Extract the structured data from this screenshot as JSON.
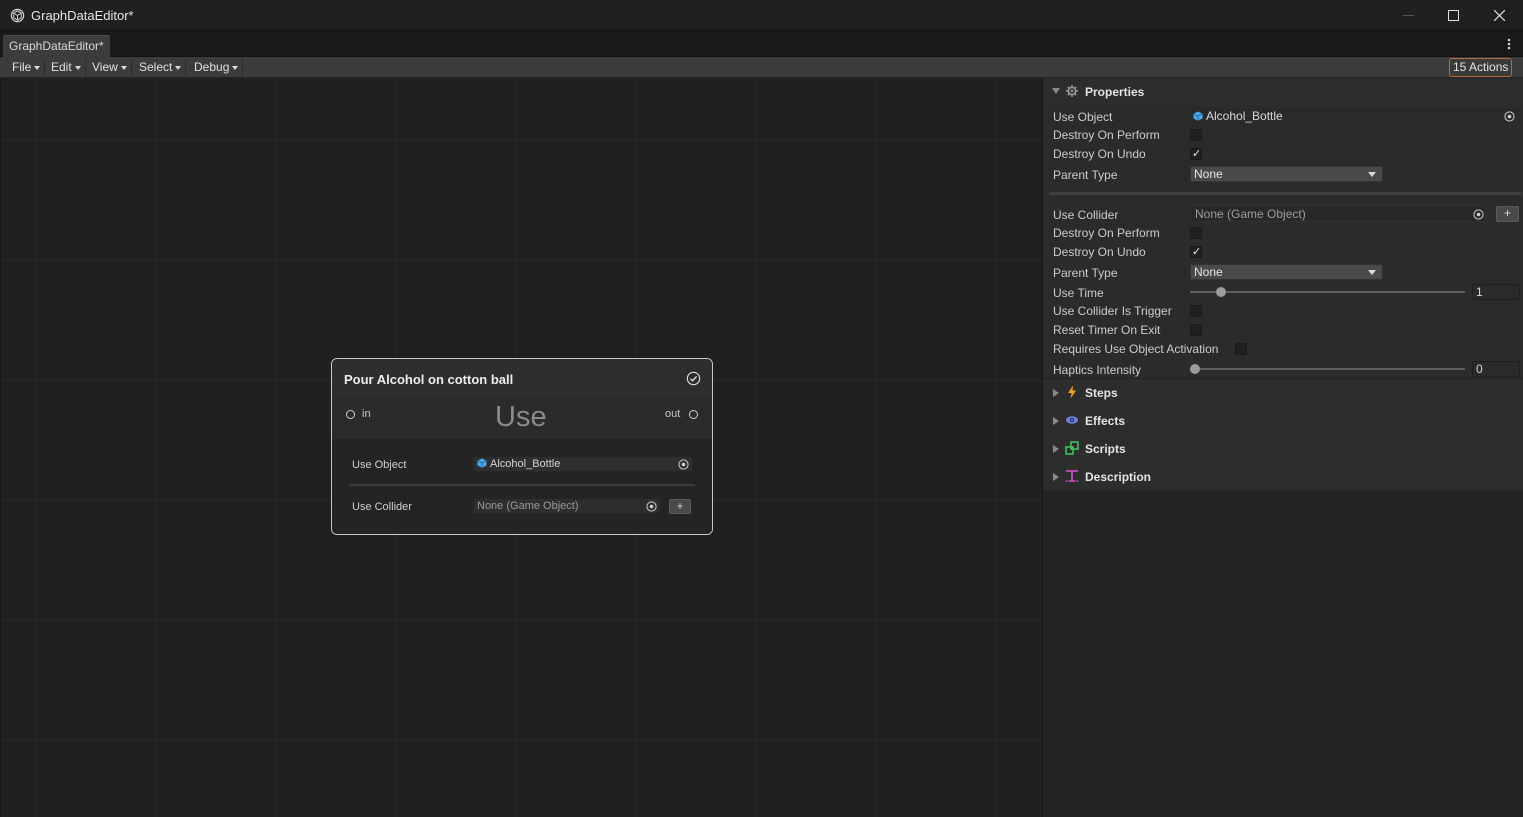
{
  "window": {
    "title": "GraphDataEditor*",
    "icon": "unity-logo-icon"
  },
  "tab": {
    "label": "GraphDataEditor*"
  },
  "menus": {
    "file": "File",
    "edit": "Edit",
    "view": "View",
    "select": "Select",
    "debug": "Debug"
  },
  "actions_badge": "15 Actions",
  "node": {
    "title": "Pour Alcohol on cotton ball",
    "type": "Use",
    "in_label": "in",
    "out_label": "out",
    "use_object_label": "Use Object",
    "use_object_value": "Alcohol_Bottle",
    "use_collider_label": "Use Collider",
    "use_collider_value": "None (Game Object)",
    "add_symbol": "+"
  },
  "inspector": {
    "properties_title": "Properties",
    "group1": {
      "use_object_label": "Use Object",
      "use_object_value": "Alcohol_Bottle",
      "destroy_on_perform_label": "Destroy On Perform",
      "destroy_on_perform": false,
      "destroy_on_undo_label": "Destroy On Undo",
      "destroy_on_undo": true,
      "parent_type_label": "Parent Type",
      "parent_type_value": "None"
    },
    "group2": {
      "use_collider_label": "Use Collider",
      "use_collider_value": "None (Game Object)",
      "add_symbol": "+",
      "destroy_on_perform_label": "Destroy On Perform",
      "destroy_on_perform": false,
      "destroy_on_undo_label": "Destroy On Undo",
      "destroy_on_undo": true,
      "parent_type_label": "Parent Type",
      "parent_type_value": "None",
      "use_time_label": "Use Time",
      "use_time_value": "1",
      "use_collider_is_trigger_label": "Use Collider Is Trigger",
      "use_collider_is_trigger": false,
      "reset_timer_on_exit_label": "Reset Timer On Exit",
      "reset_timer_on_exit": false,
      "requires_use_object_activation_label": "Requires Use Object Activation",
      "requires_use_object_activation": false,
      "haptics_intensity_label": "Haptics Intensity",
      "haptics_intensity_value": "0"
    },
    "sections": {
      "steps": "Steps",
      "effects": "Effects",
      "scripts": "Scripts",
      "description": "Description"
    },
    "check_mark": "✓"
  },
  "colors": {
    "accent_badge_border": "#b36a3d",
    "steps_icon": "#f0a020",
    "effects_icon": "#6a7ee0",
    "scripts_icon": "#3fbf5f",
    "description_icon": "#c050c0",
    "cube_icon": "#4aa8e8"
  }
}
